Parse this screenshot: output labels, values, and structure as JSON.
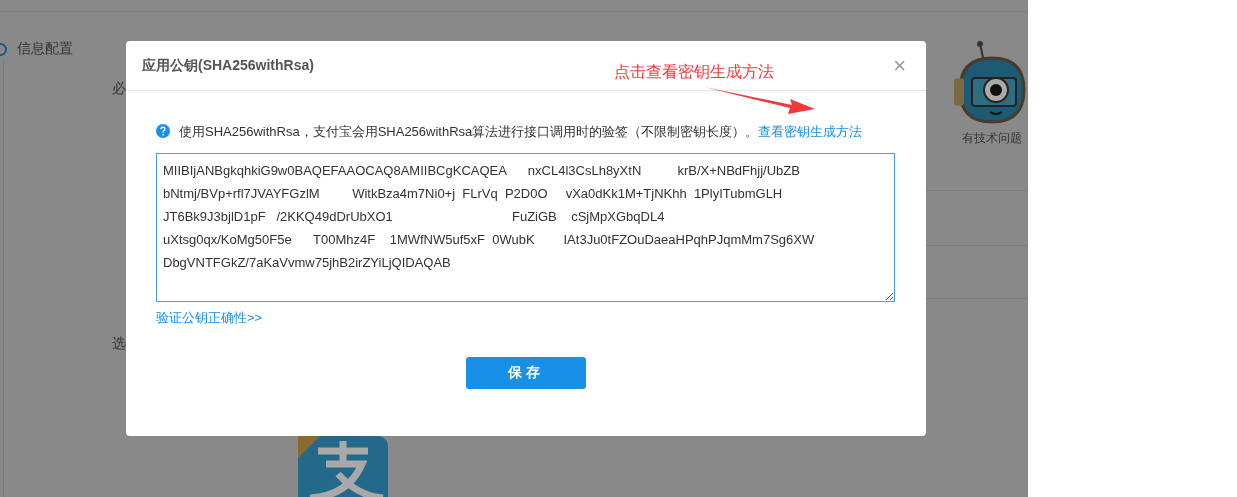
{
  "background": {
    "step": {
      "label": "信息配置"
    },
    "fragments": [
      "必",
      "选"
    ],
    "help_caption": "有技术问题"
  },
  "dialog": {
    "title": "应用公钥(SHA256withRsa)",
    "close": "×",
    "info": "使用SHA256withRsa，支付宝会用SHA256withRsa算法进行接口调用时的验签（不限制密钥长度）。",
    "info_link": "查看密钥生成方法",
    "key_lines": [
      "MIIBIjANBgkqhkiG9w0BAQEFAAOCAQ8AMIIBCgKCAQEA      nxCL4l3CsLh8yXtN          krB/X+NBdFhjj/UbZB",
      "bNtmj/BVp+rfl7JVAYFGzlM         WitkBza4m7Ni0+j  FLrVq  P2D0O     vXa0dKk1M+TjNKhh  1PlyITubmGLH",
      "JT6Bk9J3bjlD1pF   /2KKQ49dDrUbXO1                                 FuZiGB    cSjMpXGbqDL4",
      "uXtsg0qx/KoMg50F5e      T00Mhz4F    1MWfNW5uf5xF  0WubK        IAt3Ju0tFZOuDaeaHPqhPJqmMm7Sg6XW",
      "DbgVNTFGkZ/7aKaVvmw75jhB2irZYiLjQIDAQAB"
    ],
    "verify_link": "验证公钥正确性>>",
    "save_button": "保存"
  },
  "annotation": {
    "text": "点击查看密钥生成方法"
  }
}
